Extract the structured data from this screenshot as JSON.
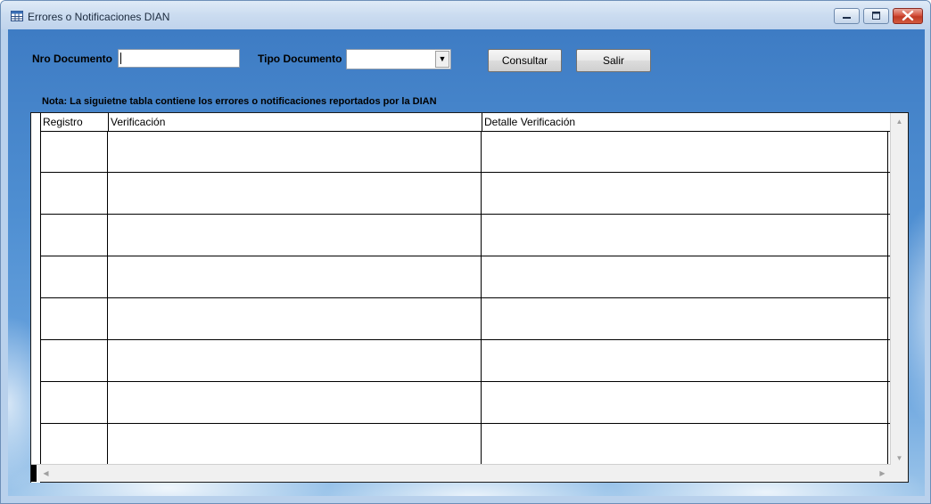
{
  "window": {
    "title": "Errores o Notificaciones DIAN",
    "controls": {
      "minimize_icon": "minimize-icon",
      "maximize_icon": "maximize-icon",
      "close_icon": "close-icon"
    }
  },
  "form": {
    "nro_documento_label": "Nro Documento",
    "nro_documento_value": "",
    "tipo_documento_label": "Tipo Documento",
    "tipo_documento_value": "",
    "consultar_label": "Consultar",
    "salir_label": "Salir"
  },
  "note": "Nota: La siguietne tabla contiene los errores o notificaciones reportados por la DIAN",
  "table": {
    "columns": [
      "Registro",
      "Verificación",
      "Detalle Verificación"
    ],
    "rows": [
      [
        "",
        "",
        ""
      ],
      [
        "",
        "",
        ""
      ],
      [
        "",
        "",
        ""
      ],
      [
        "",
        "",
        ""
      ],
      [
        "",
        "",
        ""
      ],
      [
        "",
        "",
        ""
      ],
      [
        "",
        "",
        ""
      ],
      [
        "",
        "",
        ""
      ]
    ]
  },
  "colors": {
    "title_bar": "#cbdcf0",
    "client_background": "#4f8fd2",
    "close_button": "#d5533f"
  }
}
